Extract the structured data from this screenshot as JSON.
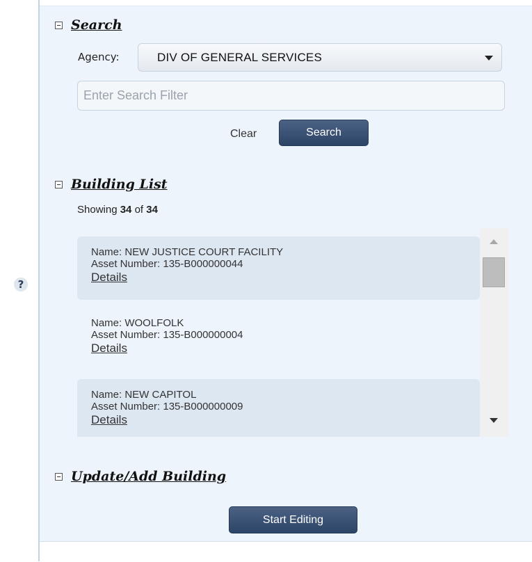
{
  "help": {
    "icon_label": "?"
  },
  "search_section": {
    "title": "Search",
    "agency_label": "Agency:",
    "agency_value": "DIV OF GENERAL SERVICES",
    "filter_placeholder": "Enter Search Filter",
    "filter_value": "",
    "clear_label": "Clear",
    "search_button": "Search"
  },
  "building_list": {
    "title": "Building List",
    "showing_prefix": "Showing",
    "showing_count": "34",
    "showing_of": "of",
    "showing_total": "34",
    "items": [
      {
        "name": "Name: NEW JUSTICE COURT FACILITY",
        "asset": "Asset Number: 135-B000000044",
        "details": "Details"
      },
      {
        "name": "Name: WOOLFOLK",
        "asset": "Asset Number: 135-B000000004",
        "details": "Details"
      },
      {
        "name": "Name: NEW CAPITOL",
        "asset": "Asset Number: 135-B000000009",
        "details": "Details"
      }
    ]
  },
  "update_section": {
    "title": "Update/Add Building",
    "start_button": "Start Editing"
  },
  "colors": {
    "panel_bg": "#eef4fb",
    "item_shade": "#dde7f2",
    "button_dark": "#2c4466"
  }
}
